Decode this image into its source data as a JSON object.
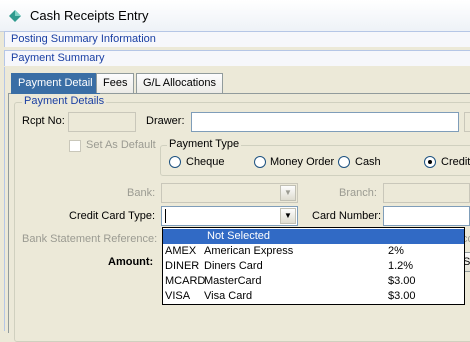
{
  "window": {
    "title": "Cash Receipts Entry"
  },
  "sections": {
    "posting_summary": "Posting Summary Information",
    "payment_summary": "Payment Summary"
  },
  "tabs": [
    {
      "label": "Payment Detail",
      "active": true
    },
    {
      "label": "Fees",
      "active": false
    },
    {
      "label": "G/L Allocations",
      "active": false
    }
  ],
  "payment_details": {
    "legend": "Payment Details",
    "rcpt_no_label": "Rcpt No:",
    "rcpt_no_value": "",
    "drawer_label": "Drawer:",
    "drawer_value": "",
    "set_as_default_label": "Set As Default",
    "payment_type": {
      "legend": "Payment Type",
      "options": [
        "Cheque",
        "Money Order",
        "Cash",
        "Credit"
      ],
      "selected": "Credit"
    },
    "bank_label": "Bank:",
    "branch_label": "Branch:",
    "credit_card_type_label": "Credit Card Type:",
    "credit_card_type_value": "",
    "card_number_label": "Card Number:",
    "bank_statement_reference_label": "Bank Statement Reference:",
    "amount_label": "Amount:"
  },
  "credit_card_dropdown": {
    "rows": [
      {
        "code": "",
        "name": "Not Selected",
        "fee": "",
        "selected": true
      },
      {
        "code": "AMEX",
        "name": "American Express",
        "fee": "2%",
        "selected": false
      },
      {
        "code": "DINER",
        "name": "Diners Card",
        "fee": "1.2%",
        "selected": false
      },
      {
        "code": "MCARD",
        "name": "MasterCard",
        "fee": "$3.00",
        "selected": false
      },
      {
        "code": "VISA",
        "name": "Visa Card",
        "fee": "$3.00",
        "selected": false
      }
    ]
  },
  "clipped": {
    "right_label_fragment": "co",
    "right_button_fragment": "S"
  },
  "colors": {
    "accent": "#3a6ea5",
    "selection": "#316ac5",
    "section_text": "#1a3fa3",
    "window_bg": "#ece9d8"
  }
}
